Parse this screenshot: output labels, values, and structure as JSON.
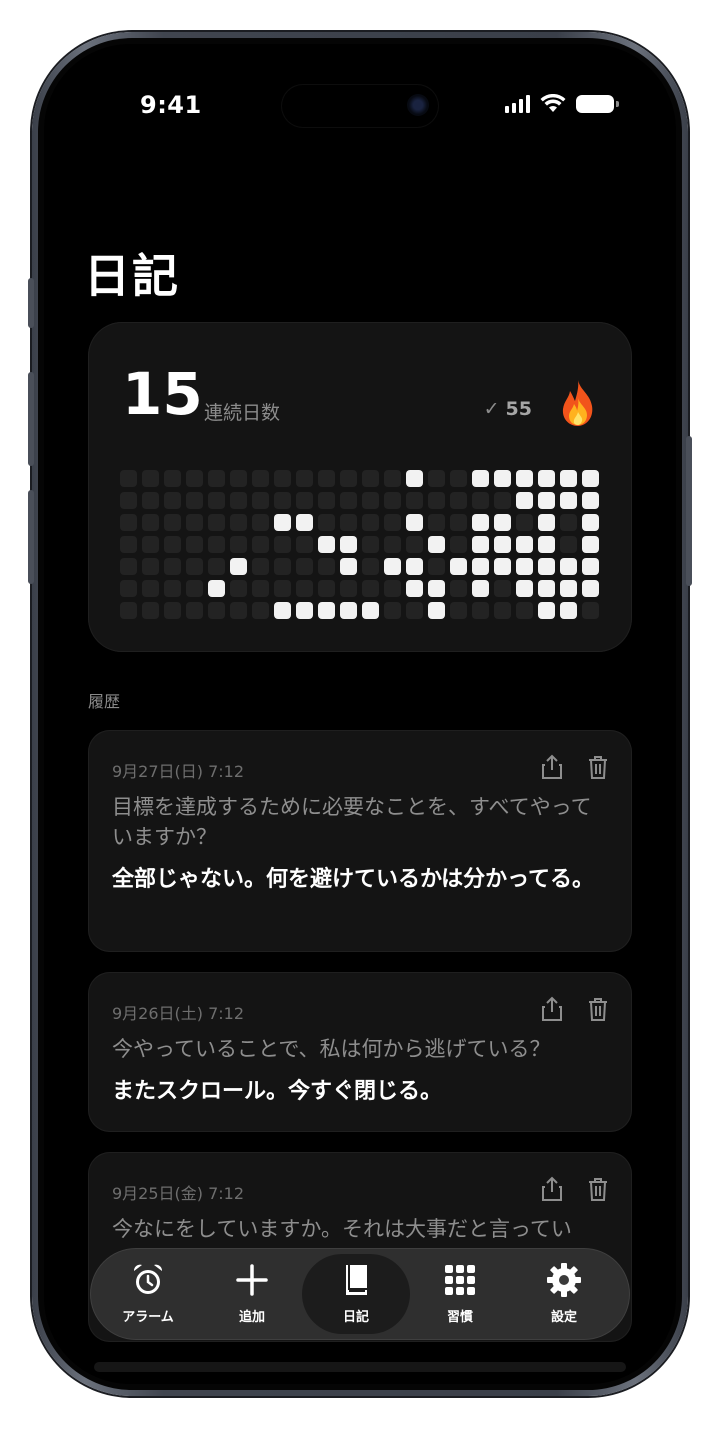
{
  "status_bar": {
    "time": "9:41"
  },
  "header": {
    "title": "日記"
  },
  "streak": {
    "count": "15",
    "label": "連続日数",
    "check_symbol": "✓",
    "completed": "55",
    "grid_rows": [
      "0000000000000100111111",
      "0000000000000000001111",
      "0000000110000100110101",
      "0000000001100010111101",
      "0000010000101101111111",
      "0000100000000110101111",
      "0000000111110010000110"
    ]
  },
  "history": {
    "section_label": "履歴",
    "entries": [
      {
        "date": "9月27日(日) 7:12",
        "question": "目標を達成するために必要なことを、すべてやっていますか？",
        "answer": "全部じゃない。何を避けているかは分かってる。"
      },
      {
        "date": "9月26日(土) 7:12",
        "question": "今やっていることで、私は何から逃げている？",
        "answer": "またスクロール。今すぐ閉じる。"
      },
      {
        "date": "9月25日(金) 7:12",
        "question": "今なにをしていますか。それは大事だと言ってい",
        "answer": ""
      }
    ]
  },
  "tabbar": {
    "tabs": [
      {
        "label": "アラーム",
        "icon": "alarm-clock-icon"
      },
      {
        "label": "追加",
        "icon": "plus-icon"
      },
      {
        "label": "日記",
        "icon": "book-icon",
        "active": true
      },
      {
        "label": "習慣",
        "icon": "grid-icon"
      },
      {
        "label": "設定",
        "icon": "gear-icon"
      }
    ]
  }
}
